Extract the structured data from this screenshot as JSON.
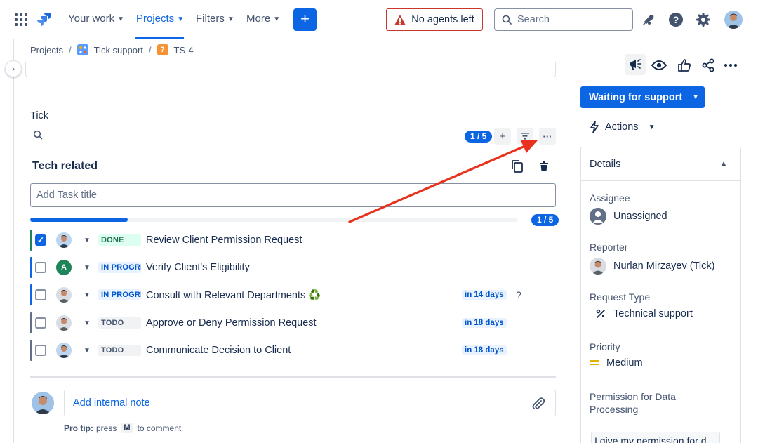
{
  "topnav": {
    "your_work": "Your work",
    "projects": "Projects",
    "filters": "Filters",
    "more": "More",
    "create": "+",
    "agents_warning": "No agents left",
    "search_placeholder": "Search"
  },
  "breadcrumb": {
    "projects": "Projects",
    "sep": "/",
    "project": "Tick support",
    "issue_icon": "?",
    "issue": "TS-4"
  },
  "tick": {
    "title": "Tick",
    "count_pill": "1 / 5",
    "add_symbol": "+",
    "more_symbol": "···",
    "list_title": "Tech related",
    "task_placeholder": "Add Task title",
    "progress_fraction": 0.2,
    "progress_pill": "1 / 5",
    "tasks": [
      {
        "title": "Review Client Permission Request",
        "status": "DONE",
        "checked": "✓",
        "due": "",
        "bar_color": "#1f845a",
        "avatar": "photo"
      },
      {
        "title": "Verify Client's Eligibility",
        "status": "IN PROGRESS",
        "checked": "",
        "due": "",
        "bar_color": "#0c66e4",
        "avatar": "A"
      },
      {
        "title": "Consult with Relevant Departments ♻️",
        "status": "IN PROGRESS",
        "checked": "",
        "due": "in 14 days",
        "help": "?",
        "bar_color": "#0c66e4",
        "avatar": "photo"
      },
      {
        "title": "Approve or Deny Permission Request",
        "status": "TODO",
        "checked": "",
        "due": "in 18 days",
        "bar_color": "#626f86",
        "avatar": "photo"
      },
      {
        "title": "Communicate Decision to Client",
        "status": "TODO",
        "checked": "",
        "due": "in 18 days",
        "bar_color": "#626f86",
        "avatar": "photo"
      }
    ]
  },
  "comment": {
    "placeholder": "Add internal note",
    "protip_prefix": "Pro tip:",
    "protip_press": "press",
    "protip_key": "M",
    "protip_suffix": "to comment"
  },
  "right_panel": {
    "status": "Waiting for support",
    "actions": "Actions",
    "details_title": "Details",
    "fields": [
      {
        "label": "Assignee",
        "value": "Unassigned"
      },
      {
        "label": "Reporter",
        "value": "Nurlan Mirzayev (Tick)"
      },
      {
        "label": "Request Type",
        "value": "Technical support"
      },
      {
        "label": "Priority",
        "value": "Medium"
      }
    ],
    "permission_label": "Permission for Data Processing",
    "permission_value": "I give my permission for data processing"
  },
  "colors": {
    "brand": "#0c66e4",
    "danger": "#c9372c",
    "annotation_arrow": "#e8321e",
    "priority_medium": "#e2b203"
  },
  "icons": [
    "app-switcher-icon",
    "jira-logo-icon",
    "warning-icon",
    "search-icon",
    "notification-icon",
    "help-icon",
    "settings-icon",
    "copy-icon",
    "trash-icon",
    "filter-icon",
    "attachment-icon",
    "megaphone-icon",
    "watch-icon",
    "thumbs-up-icon",
    "share-icon",
    "lightning-icon",
    "technical-support-icon",
    "priority-medium-icon"
  ]
}
